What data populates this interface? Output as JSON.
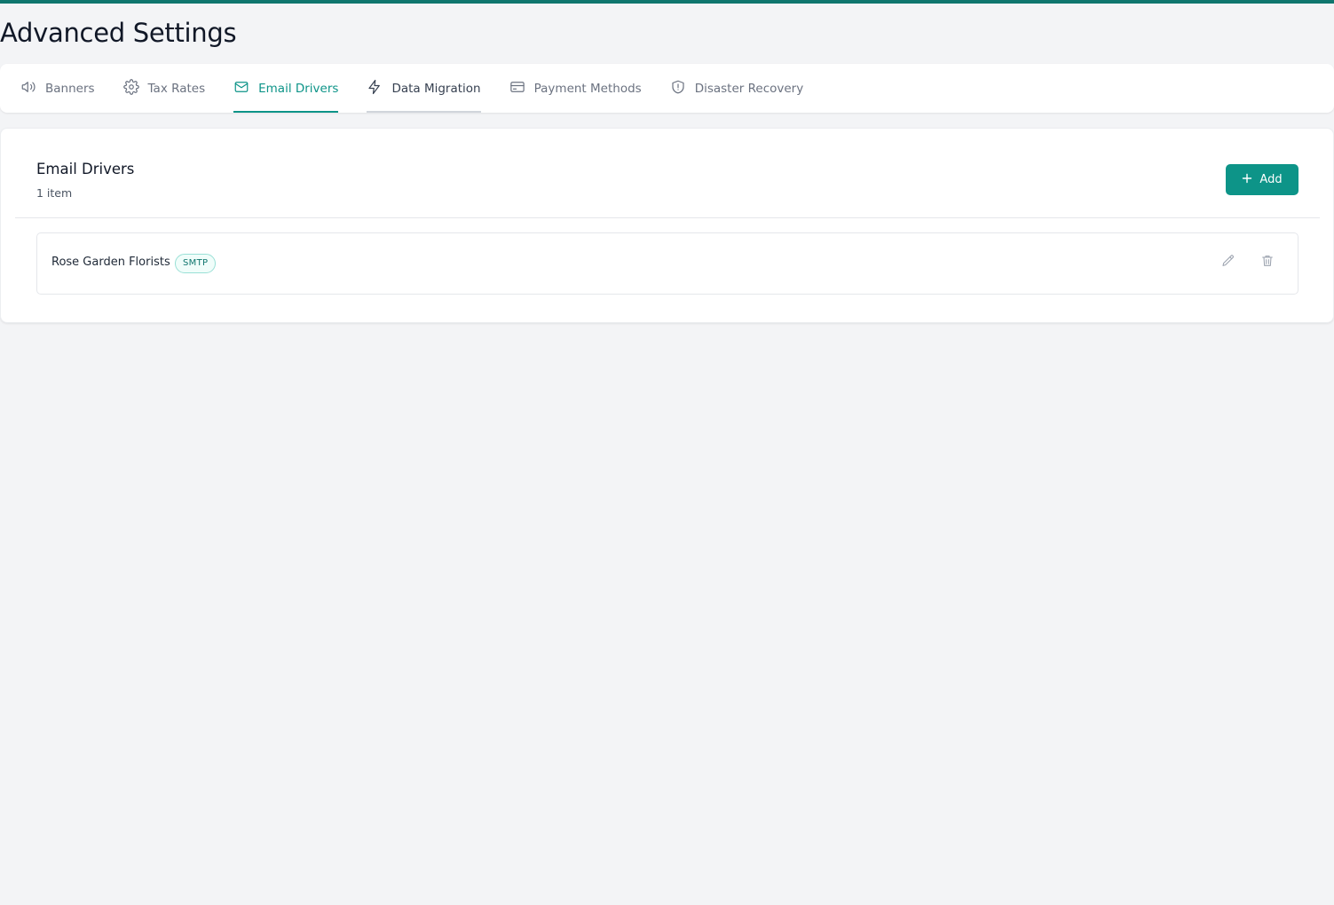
{
  "page": {
    "title": "Advanced Settings"
  },
  "tabs": [
    {
      "label": "Banners",
      "icon": "megaphone-icon",
      "state": "default"
    },
    {
      "label": "Tax Rates",
      "icon": "gear-icon",
      "state": "default"
    },
    {
      "label": "Email Drivers",
      "icon": "mail-icon",
      "state": "active"
    },
    {
      "label": "Data Migration",
      "icon": "lightning-icon",
      "state": "hover"
    },
    {
      "label": "Payment Methods",
      "icon": "credit-card-icon",
      "state": "default"
    },
    {
      "label": "Disaster Recovery",
      "icon": "shield-alert-icon",
      "state": "default"
    }
  ],
  "section": {
    "title": "Email Drivers",
    "count": "1 item",
    "add_label": "Add"
  },
  "drivers": [
    {
      "name": "Rose Garden Florists",
      "type": "SMTP"
    }
  ],
  "colors": {
    "accent": "#0d9488",
    "accent_dark": "#0f766e",
    "background": "#f3f4f6",
    "muted_text": "#6b7280"
  }
}
